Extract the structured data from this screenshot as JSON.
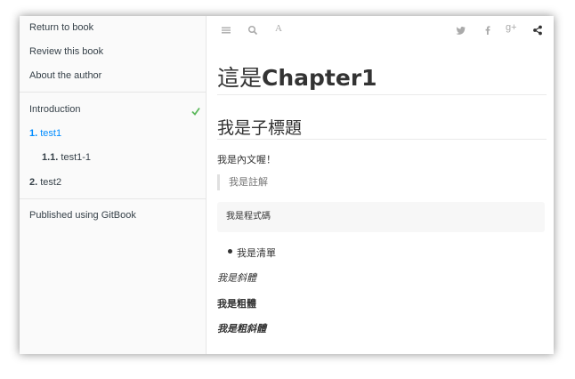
{
  "sidebar": {
    "top_links": [
      {
        "label": "Return to book"
      },
      {
        "label": "Review this book"
      },
      {
        "label": "About the author"
      }
    ],
    "chapters": [
      {
        "number": "",
        "label": "Introduction",
        "completed": true
      },
      {
        "number": "1.",
        "label": "test1",
        "active": true
      },
      {
        "number": "1.1.",
        "label": "test1-1"
      },
      {
        "number": "2.",
        "label": "test2"
      }
    ],
    "footer": "Published using GitBook"
  },
  "toolbar": {
    "left_icons": [
      "menu-icon",
      "search-icon",
      "font-icon"
    ],
    "font_glyph": "A",
    "right_icons": [
      "twitter-icon",
      "facebook-icon",
      "google-plus-icon",
      "share-icon"
    ],
    "gplus_glyph": "g+"
  },
  "content": {
    "h1_prefix": "這是",
    "h1_main": "Chapter1",
    "h2": "我是子標題",
    "paragraph": "我是內文喔！",
    "blockquote": "我是註解",
    "code": "我是程式碼",
    "list_items": [
      "我是清單"
    ],
    "italic": "我是斜體",
    "bold": "我是粗體",
    "bold_italic": "我是粗斜體"
  },
  "colors": {
    "active_link": "#008cff",
    "check": "#5cb85c",
    "toolbar_icon": "#aaaaaa",
    "share_icon": "#333333"
  }
}
